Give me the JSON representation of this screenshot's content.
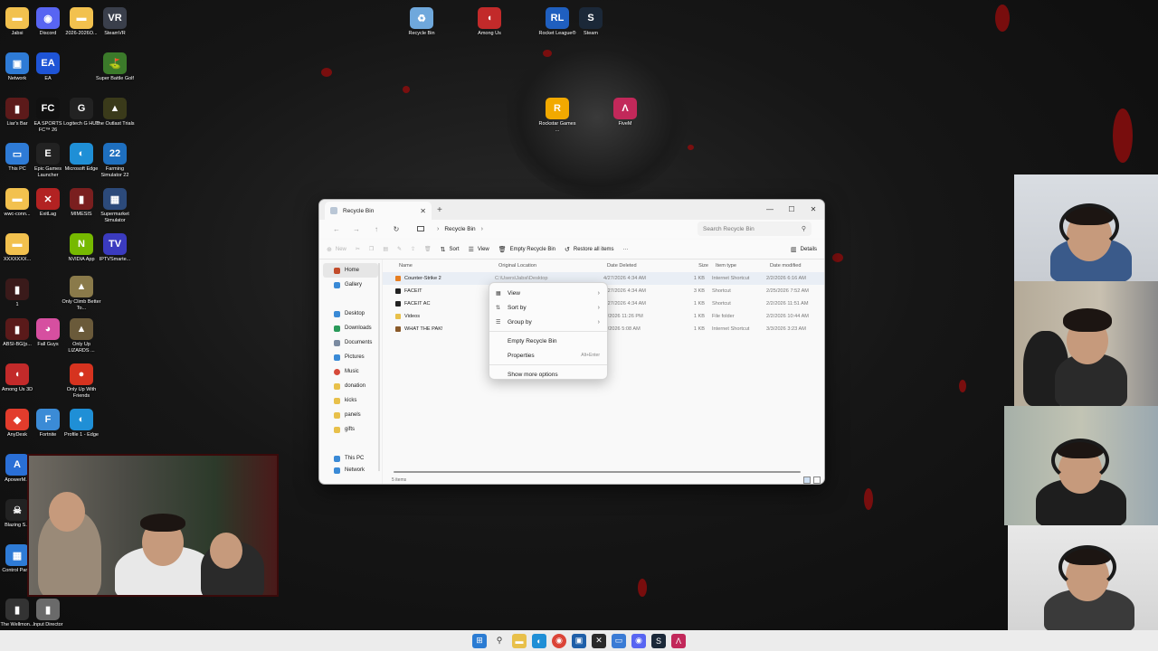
{
  "desktop": {
    "icons": [
      {
        "label": "Jabsi",
        "color": "#f2c14e",
        "glyph": "▬"
      },
      {
        "label": "Discord",
        "color": "#5865f2",
        "glyph": "◉"
      },
      {
        "label": "2026-2026O...",
        "color": "#f2c14e",
        "glyph": "▬"
      },
      {
        "label": "SteamVR",
        "color": "#3a3f4b",
        "glyph": "VR"
      },
      {
        "label": "Network",
        "color": "#2e7bd6",
        "glyph": "▣"
      },
      {
        "label": "EA",
        "color": "#1e54d6",
        "glyph": "EA"
      },
      {
        "label": "Super Battle Golf",
        "color": "#3b7a2a",
        "glyph": "⛳"
      },
      {
        "label": "Liar's Bar",
        "color": "#5c1a1a",
        "glyph": "▮"
      },
      {
        "label": "EA SPORTS FC™ 26",
        "color": "#111111",
        "glyph": "FC"
      },
      {
        "label": "Logitech G HUB",
        "color": "#222222",
        "glyph": "G"
      },
      {
        "label": "The Outlast Trials",
        "color": "#3a3a1a",
        "glyph": "▲"
      },
      {
        "label": "This PC",
        "color": "#2e7bd6",
        "glyph": "▭"
      },
      {
        "label": "Epic Games Launcher",
        "color": "#222222",
        "glyph": "E"
      },
      {
        "label": "Microsoft Edge",
        "color": "#1f8fd6",
        "glyph": "◐"
      },
      {
        "label": "Farming Simulator 22",
        "color": "#1e6fbf",
        "glyph": "22"
      },
      {
        "label": "wwc-conn...",
        "color": "#f2c14e",
        "glyph": "▬"
      },
      {
        "label": "ExitLag",
        "color": "#b22222",
        "glyph": "✕"
      },
      {
        "label": "MIMESIS",
        "color": "#7a1f1f",
        "glyph": "▮"
      },
      {
        "label": "Supermarket Simulator",
        "color": "#2c4a7a",
        "glyph": "▦"
      },
      {
        "label": "XXXXXXX...",
        "color": "#f2c14e",
        "glyph": "▬"
      },
      {
        "label": "NVIDIA App",
        "color": "#76b900",
        "glyph": "N"
      },
      {
        "label": "IPTVSmarte...",
        "color": "#3b3bbf",
        "glyph": "TV"
      },
      {
        "label": "Only Climb Better To...",
        "color": "#8a7a4a",
        "glyph": "▲"
      },
      {
        "label": "1",
        "color": "#3a1a1a",
        "glyph": "▮"
      },
      {
        "label": "Fall Guys",
        "color": "#d64fa0",
        "glyph": "◕"
      },
      {
        "label": "ABSI-BG(p...",
        "color": "#5a1a1a",
        "glyph": "▮"
      },
      {
        "label": "Only Up LIZARDS ...",
        "color": "#6a5a3a",
        "glyph": "▲"
      },
      {
        "label": "Among Us 3D",
        "color": "#c22a2a",
        "glyph": "◖"
      },
      {
        "label": "Only Up With Friends",
        "color": "#d6331f",
        "glyph": "●"
      },
      {
        "label": "AnyDesk",
        "color": "#e23c2c",
        "glyph": "◆"
      },
      {
        "label": "Fortnite",
        "color": "#3b8bd6",
        "glyph": "F"
      },
      {
        "label": "Profile 1 - Edge",
        "color": "#1f8fd6",
        "glyph": "◐"
      },
      {
        "label": "ApowerM...",
        "color": "#2a6fd6",
        "glyph": "A"
      },
      {
        "label": "Blazing S...",
        "color": "#222222",
        "glyph": "☠"
      },
      {
        "label": "Control Panel",
        "color": "#2e7bd6",
        "glyph": "▦"
      },
      {
        "label": "The Wellmon...",
        "color": "#333333",
        "glyph": "▮"
      },
      {
        "label": "Input Director",
        "color": "#6a6a6a",
        "glyph": "▮"
      },
      {
        "label": "Recycle Bin",
        "color": "#6fa8dc",
        "glyph": "♻"
      },
      {
        "label": "Among Us",
        "color": "#c22a2a",
        "glyph": "◖"
      },
      {
        "label": "Rocket League®",
        "color": "#1f5fbf",
        "glyph": "RL"
      },
      {
        "label": "Steam",
        "color": "#1b2838",
        "glyph": "S"
      },
      {
        "label": "Rockstar Games ...",
        "color": "#f2a900",
        "glyph": "R"
      },
      {
        "label": "FiveM",
        "color": "#c2285a",
        "glyph": "Λ"
      }
    ]
  },
  "explorer": {
    "tab_title": "Recycle Bin",
    "breadcrumb": "Recycle Bin",
    "search_placeholder": "Search Recycle Bin",
    "toolbar": {
      "new": "New",
      "sort": "Sort",
      "view": "View",
      "empty": "Empty Recycle Bin",
      "restore_all": "Restore all items",
      "more": "···",
      "details": "Details"
    },
    "nav": {
      "home": "Home",
      "gallery": "Gallery",
      "desktop": "Desktop",
      "downloads": "Downloads",
      "documents": "Documents",
      "pictures": "Pictures",
      "music": "Music",
      "donation": "donation",
      "kicks": "kicks",
      "panels": "panels",
      "gifts": "gifts",
      "this_pc": "This PC",
      "network": "Network"
    },
    "columns": {
      "name": "Name",
      "original_location": "Original Location",
      "date_deleted": "Date Deleted",
      "size": "Size",
      "item_type": "Item type",
      "date_modified": "Date modified"
    },
    "rows": [
      {
        "name": "Counter-Strike 2",
        "location": "C:\\Users\\Jabsi\\Desktop",
        "deleted": "4/27/2026 4:34 AM",
        "size": "1 KB",
        "type": "Internet Shortcut",
        "modified": "2/2/2026 6:16 AM"
      },
      {
        "name": "FACEIT",
        "location": "",
        "deleted": "4/27/2026 4:34 AM",
        "size": "3 KB",
        "type": "Shortcut",
        "modified": "2/25/2026 7:52 AM"
      },
      {
        "name": "FACEIT AC",
        "location": "",
        "deleted": "4/27/2026 4:34 AM",
        "size": "1 KB",
        "type": "Shortcut",
        "modified": "2/2/2026 11:51 AM"
      },
      {
        "name": "Videos",
        "location": "",
        "deleted": "/7/2026 11:26 PM",
        "size": "1 KB",
        "type": "File folder",
        "modified": "2/2/2026 10:44 AM"
      },
      {
        "name": "WHAT THE PAK!",
        "location": "",
        "deleted": "/7/2026 5:08 AM",
        "size": "1 KB",
        "type": "Internet Shortcut",
        "modified": "3/3/2026 3:23 AM"
      }
    ],
    "status": "5 items"
  },
  "context_menu": {
    "view": "View",
    "sort_by": "Sort by",
    "group_by": "Group by",
    "empty": "Empty Recycle Bin",
    "properties": "Properties",
    "properties_shortcut": "Alt+Enter",
    "more_options": "Show more options"
  }
}
